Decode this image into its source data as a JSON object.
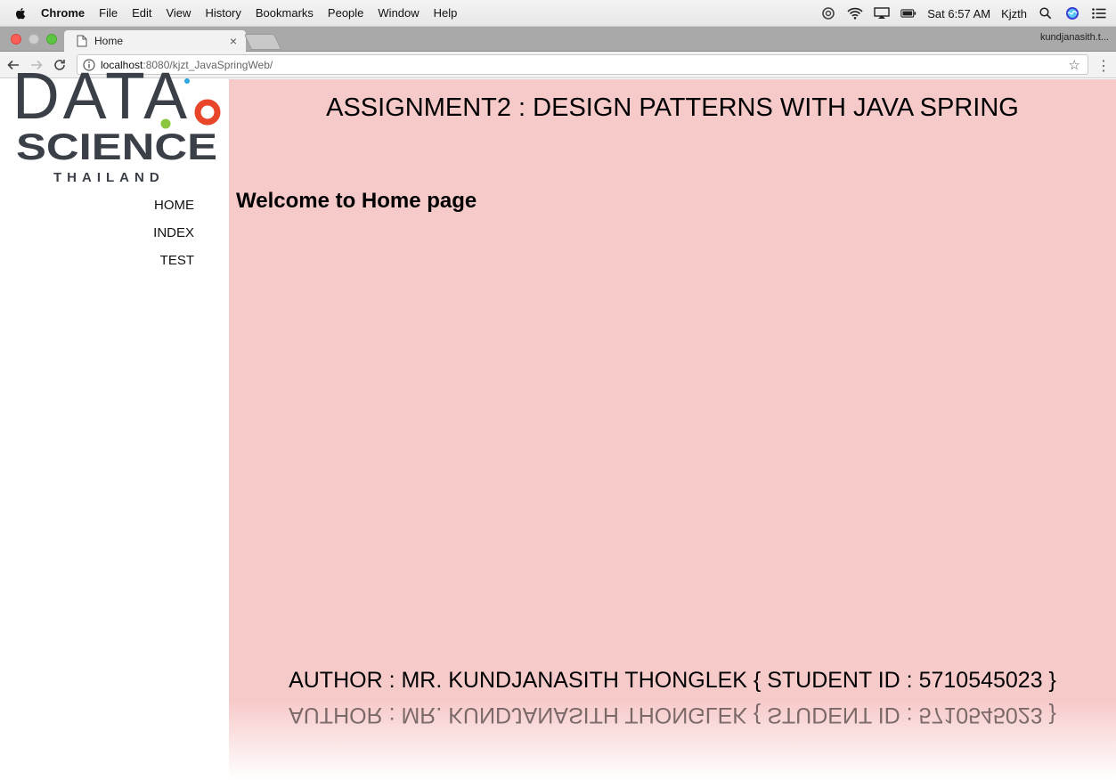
{
  "menubar": {
    "app_name": "Chrome",
    "items": [
      "File",
      "Edit",
      "View",
      "History",
      "Bookmarks",
      "People",
      "Window",
      "Help"
    ],
    "clock": "Sat 6:57 AM",
    "user": "Kjzth"
  },
  "tabs": {
    "active_title": "Home",
    "close_glyph": "×",
    "profile_name": "kundjanasith.t..."
  },
  "address": {
    "host": "localhost",
    "path": ":8080/kjzt_JavaSpringWeb/"
  },
  "logo": {
    "line1": "DATA",
    "line2": "SCIENCE",
    "line3": "THAILAND"
  },
  "nav": {
    "items": [
      "HOME",
      "INDEX",
      "TEST"
    ]
  },
  "main": {
    "heading": "ASSIGNMENT2 : DESIGN PATTERNS WITH JAVA SPRING",
    "welcome": "Welcome to Home page",
    "author": "AUTHOR : MR. KUNDJANASITH THONGLEK { STUDENT ID : 5710545023 }"
  },
  "colors": {
    "content_bg": "#f7caca",
    "logo_text": "#3a3f48",
    "logo_orange": "#e8452a",
    "logo_green": "#8cc63f",
    "logo_blue": "#29a6de"
  },
  "icons": [
    "apple-icon",
    "creative-cloud-icon",
    "wifi-icon",
    "airplay-icon",
    "battery-icon",
    "spotlight-icon",
    "siri-icon",
    "notification-center-icon",
    "document-icon",
    "back-icon",
    "forward-icon",
    "reload-icon",
    "info-icon",
    "bookmark-star-icon",
    "chrome-menu-icon"
  ]
}
